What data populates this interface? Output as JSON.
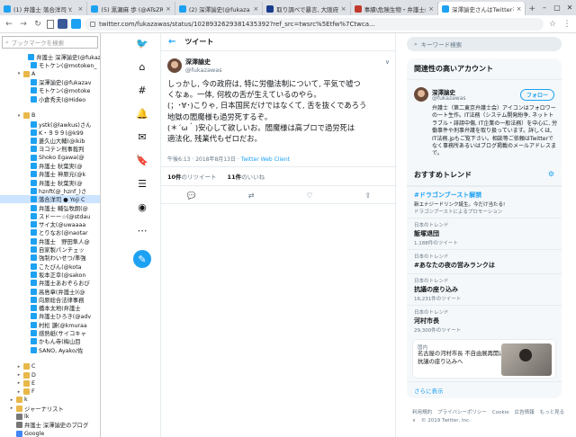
{
  "browser": {
    "tabs": [
      {
        "label": "(1) 弁護士 落合洋司 Y.",
        "color": "#1da1f2"
      },
      {
        "label": "(5) 黒瀬麻 歩 (@ATsZR.",
        "color": "#1da1f2"
      },
      {
        "label": "(2) 深澤諭史(@fukazaw.",
        "color": "#1da1f2"
      },
      {
        "label": "取り調べで暴言, 大阪府警",
        "color": "#1a3c8c"
      },
      {
        "label": "事績\\危険生物・弁護士に",
        "color": "#c0392b"
      },
      {
        "label": "深澤諭史さんはTwitterを",
        "color": "#1da1f2",
        "active": true
      }
    ],
    "url": "twitter.com/fukazawas/status/1028932629381435392?ref_src=twsrc%5Etfw%7Ctwca..."
  },
  "sidebar": {
    "search_placeholder": "ブックマークを検索",
    "items": [
      {
        "label": "弁護士 深澤諭史(@fukaz",
        "indent": 3,
        "type": "tw"
      },
      {
        "label": "モトケン(@motoken_",
        "indent": 3,
        "type": "tw"
      },
      {
        "label": "A",
        "indent": 2,
        "type": "folder",
        "open": true
      },
      {
        "label": "深澤諭史(@fukazav",
        "indent": 3,
        "type": "tw"
      },
      {
        "label": "モトケン(@motoke",
        "indent": 3,
        "type": "tw"
      },
      {
        "label": "小倉秀夫(@Hideo",
        "indent": 3,
        "type": "tw"
      },
      {
        "label": "",
        "indent": 3,
        "type": "blank"
      },
      {
        "label": "B",
        "indent": 2,
        "type": "folder",
        "open": true
      },
      {
        "label": "ystk(@lawkus)さん",
        "indent": 3,
        "type": "tw"
      },
      {
        "label": "K・９９９(@k99",
        "indent": 3,
        "type": "tw"
      },
      {
        "label": "菱久山大輔(@ikib",
        "indent": 3,
        "type": "tw"
      },
      {
        "label": "ヨコテン刑事裁判",
        "indent": 3,
        "type": "tw"
      },
      {
        "label": "Shoko Egawa(@",
        "indent": 3,
        "type": "tw"
      },
      {
        "label": "弁護士 秋葉実(@",
        "indent": 3,
        "type": "tw"
      },
      {
        "label": "弁護士 神原元(@k",
        "indent": 3,
        "type": "tw"
      },
      {
        "label": "弁護士 秋葉実(@",
        "indent": 3,
        "type": "tw"
      },
      {
        "label": "hznft(@_hznf_)さ",
        "indent": 3,
        "type": "tw"
      },
      {
        "label": "落合洋司 ● Yoji C",
        "indent": 3,
        "type": "tw",
        "selected": true
      },
      {
        "label": "弁護士 輔弘牧朗(@",
        "indent": 3,
        "type": "tw"
      },
      {
        "label": "スドーー☆(@stdau",
        "indent": 3,
        "type": "tw"
      },
      {
        "label": "サイ太(@uwaaaa",
        "indent": 3,
        "type": "tw"
      },
      {
        "label": "とりなお(@naotar",
        "indent": 3,
        "type": "tw"
      },
      {
        "label": "弁護士　野田隼人@",
        "indent": 3,
        "type": "tw"
      },
      {
        "label": "自家製パンチェッ",
        "indent": 3,
        "type": "tw"
      },
      {
        "label": "強制わいせつ/準強",
        "indent": 3,
        "type": "tw"
      },
      {
        "label": "こたびん(@kota",
        "indent": 3,
        "type": "tw"
      },
      {
        "label": "坂本正幸(@sakon",
        "indent": 3,
        "type": "tw"
      },
      {
        "label": "弁護士あおぞらおび",
        "indent": 3,
        "type": "tw"
      },
      {
        "label": "高島章(弁護士)(@",
        "indent": 3,
        "type": "tw"
      },
      {
        "label": "向原総合法律事務",
        "indent": 3,
        "type": "tw"
      },
      {
        "label": "橋本太地(弁護士",
        "indent": 3,
        "type": "tw"
      },
      {
        "label": "弁護士ひろき(@adv",
        "indent": 3,
        "type": "tw"
      },
      {
        "label": "村松 謙(@kmuraa",
        "indent": 3,
        "type": "tw"
      },
      {
        "label": "感熱紙(サイコキャ",
        "indent": 3,
        "type": "tw"
      },
      {
        "label": "かもん寺(梅山目",
        "indent": 3,
        "type": "tw"
      },
      {
        "label": "SANO, Ayako/佐",
        "indent": 3,
        "type": "tw"
      },
      {
        "label": "",
        "indent": 3,
        "type": "blank"
      },
      {
        "label": "C",
        "indent": 2,
        "type": "folder"
      },
      {
        "label": "D",
        "indent": 2,
        "type": "folder"
      },
      {
        "label": "E",
        "indent": 2,
        "type": "folder"
      },
      {
        "label": "F",
        "indent": 2,
        "type": "folder"
      },
      {
        "label": "k",
        "indent": 1,
        "type": "folder"
      },
      {
        "label": "ジャーナリスト",
        "indent": 1,
        "type": "folder"
      },
      {
        "label": "lk",
        "indent": 1,
        "type": "page"
      },
      {
        "label": "弁護士 深澤諭史のブログ",
        "indent": 1,
        "type": "page"
      },
      {
        "label": "Google",
        "indent": 1,
        "type": "google"
      }
    ]
  },
  "twitter": {
    "header_title": "ツイート",
    "author_name": "深澤諭史",
    "author_handle": "@fukazawas",
    "tweet_lines": [
      "しっかし, 今の政府は, 特に労働法制について, 平気で嘘つ",
      "くなぁ。一体, 何枚の舌が生えているのやら。",
      "(；･∀･)こりゃ, 日本国民だけではなくて, 舌を抜くであろう",
      "地獄の閻魔様も過労死するぞ。",
      "(＊´ω｀)安心して欲しいお。閻魔様は高プロで過労死は",
      "適法化, 残業代もゼロだお。"
    ],
    "meta_time": "午後6:13 · 2018年8月13日 · ",
    "meta_client": "Twitter Web Client",
    "retweets_count": "10件",
    "retweets_label": "のリツイート",
    "likes_count": "11件",
    "likes_label": "のいいね",
    "search_placeholder": "キーワード検索",
    "related_title": "関連性の高いアカウント",
    "related_name": "深澤諭史",
    "related_handle": "@fukazawas",
    "follow_label": "フォロー",
    "related_bio": "弁護士（第二東京弁護士会）アイコンはフォロワーの一ト生作。IT法務（システム開発紛争, ネットトラブル・誹謗中傷, IT企業の一般法務）を中心に, 労働事件や刑事弁護を取り扱っています。詳しくは, IT法務.jpもご覧下さい。相談等ご依頼はTwitterでなく事務所あるいはブログ掲載のメールアドレスまで。",
    "trends_title": "おすすめトレンド",
    "trends": [
      {
        "ctx": "",
        "name": "#ドラゴンブースト解禁",
        "extra": "新エナジードリンク誕生。今だけ当たる!",
        "count": "ドラゴンブーストによるプロモーション",
        "promo": true
      },
      {
        "ctx": "日本のトレンド",
        "name": "飯塚退団",
        "extra": "",
        "count": "1,188件のツイート"
      },
      {
        "ctx": "日本のトレンド",
        "name": "#あなたの夜の営みランクは",
        "extra": "",
        "count": ""
      },
      {
        "ctx": "日本のトレンド",
        "name": "抗議の座り込み",
        "extra": "",
        "count": "16,231件のツイート"
      },
      {
        "ctx": "日本のトレンド",
        "name": "河村市長",
        "extra": "",
        "count": "29,300件のツイート"
      }
    ],
    "news_ctx": "国内",
    "news_text": "名古屋の河村市長 不自由展再開に抗議の座り込みへ",
    "more_label": "さらに表示",
    "footer": [
      "利用規約",
      "プライバシーポリシー",
      "Cookie",
      "広告情報",
      "もっと見る ∨",
      "© 2019 Twitter, Inc."
    ]
  }
}
